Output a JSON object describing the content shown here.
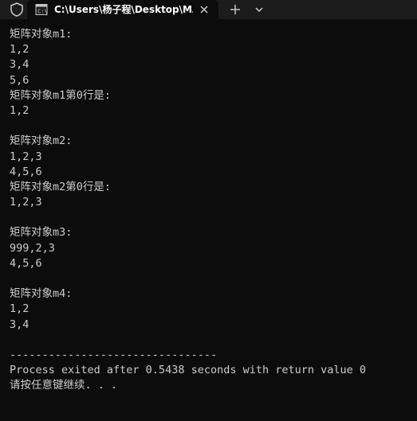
{
  "window": {
    "tab_title": "C:\\Users\\杨子程\\Desktop\\MAT"
  },
  "icons": {
    "security": "shield-icon",
    "tab": "console-icon",
    "close": "close-icon",
    "new_tab": "plus-icon",
    "dropdown": "chevron-down-icon"
  },
  "colors": {
    "background": "#0c0c0c",
    "text": "#cccccc",
    "titlebar": "#1c1c1c"
  },
  "console": {
    "lines": [
      "矩阵对象m1:",
      "1,2",
      "3,4",
      "5,6",
      "矩阵对象m1第0行是:",
      "1,2",
      "",
      "矩阵对象m2:",
      "1,2,3",
      "4,5,6",
      "矩阵对象m2第0行是:",
      "1,2,3",
      "",
      "矩阵对象m3:",
      "999,2,3",
      "4,5,6",
      "",
      "矩阵对象m4:",
      "1,2",
      "3,4",
      "",
      "--------------------------------",
      "Process exited after 0.5438 seconds with return value 0",
      "请按任意键继续. . ."
    ]
  }
}
